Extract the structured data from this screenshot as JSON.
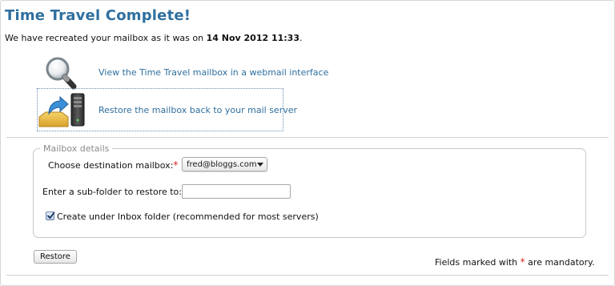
{
  "title": "Time Travel Complete!",
  "intro": {
    "text_before": "We have recreated your mailbox as it was on",
    "date": "14 Nov 2012 11:33",
    "text_after": "."
  },
  "actions": [
    {
      "label": "View the Time Travel mailbox in a webmail interface",
      "icon": "magnifier-icon"
    },
    {
      "label": "Restore the mailbox back to your mail server",
      "icon": "restore-to-server-icon"
    }
  ],
  "details": {
    "legend": "Mailbox details",
    "destination_label": "Choose destination mailbox:",
    "destination_value": "fred@bloggs.com",
    "subfolder_label": "Enter a sub-folder to restore to:",
    "subfolder_value": "",
    "inbox_checkbox_label": "Create under Inbox folder (recommended for most servers)",
    "inbox_checked": true
  },
  "restore_button": "Restore",
  "mandatory_note": {
    "before": "Fields marked with",
    "star": "*",
    "after": "are mandatory."
  },
  "colors": {
    "title": "#2f6f9f",
    "link": "#2f6f9f",
    "required": "#dd2222"
  }
}
